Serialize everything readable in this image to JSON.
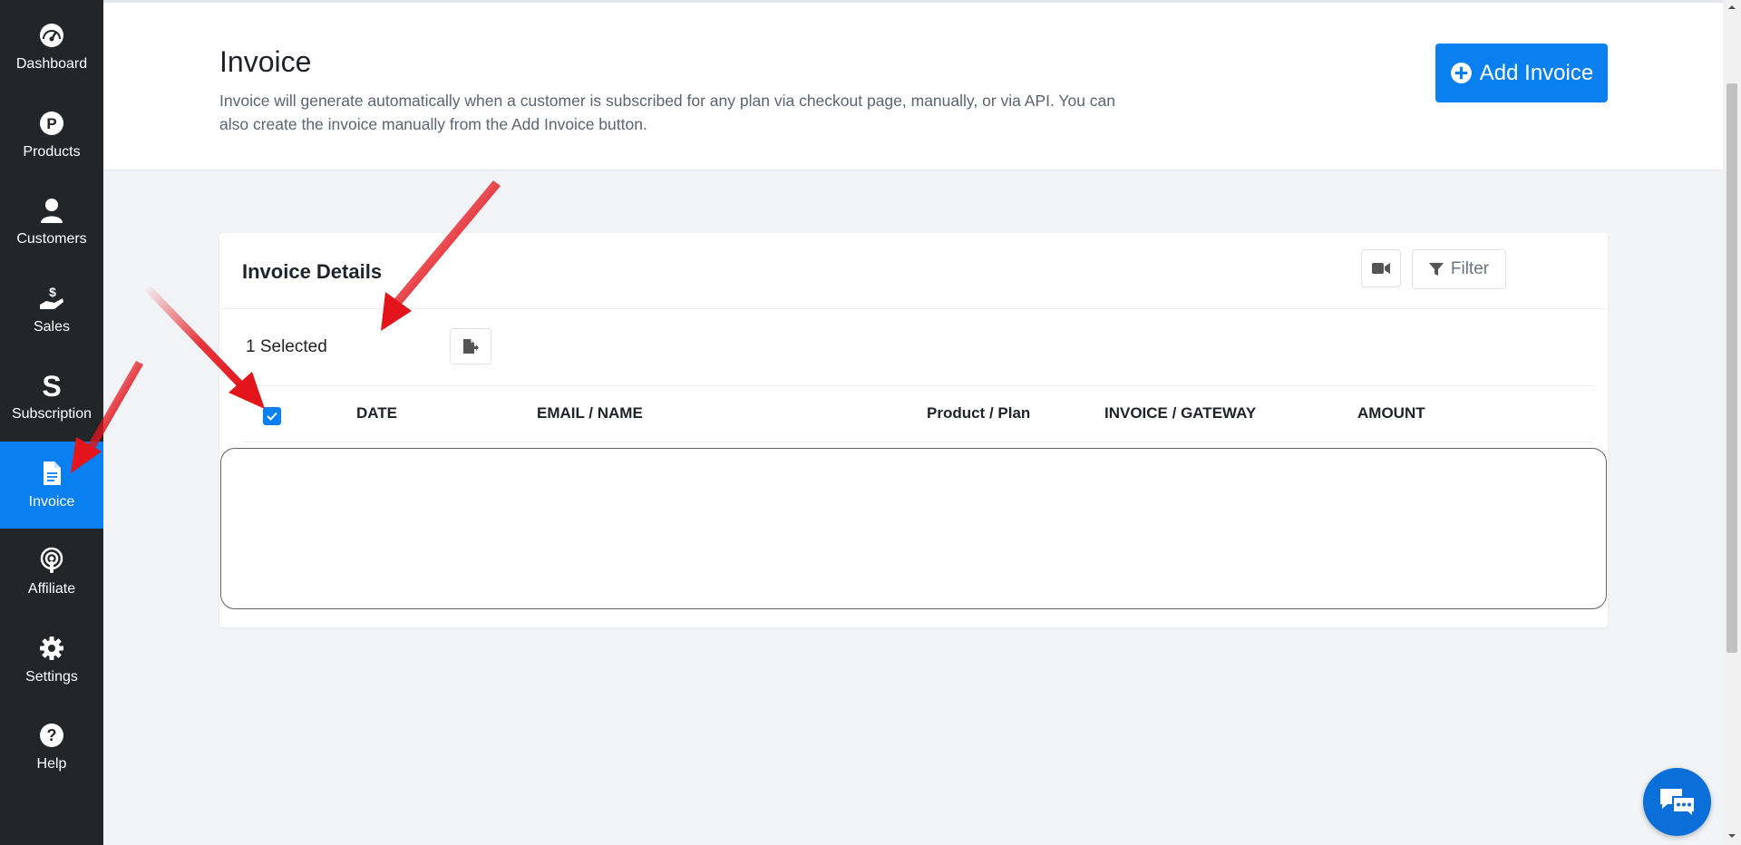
{
  "sidebar": {
    "items": [
      {
        "label": "Dashboard",
        "icon": "gauge-icon",
        "active": false
      },
      {
        "label": "Products",
        "icon": "product-p-icon",
        "active": false
      },
      {
        "label": "Customers",
        "icon": "user-icon",
        "active": false
      },
      {
        "label": "Sales",
        "icon": "hand-dollar-icon",
        "active": false
      },
      {
        "label": "Subscription",
        "icon": "subscription-s-icon",
        "active": false
      },
      {
        "label": "Invoice",
        "icon": "document-icon",
        "active": true
      },
      {
        "label": "Affiliate",
        "icon": "broadcast-icon",
        "active": false
      },
      {
        "label": "Settings",
        "icon": "gear-icon",
        "active": false
      },
      {
        "label": "Help",
        "icon": "question-icon",
        "active": false
      }
    ]
  },
  "header": {
    "title": "Invoice",
    "description": "Invoice will generate automatically when a customer is subscribed for any plan via checkout page, manually, or via API. You can also create the invoice manually from the Add Invoice button.",
    "add_button_label": "Add Invoice"
  },
  "card": {
    "title": "Invoice Details",
    "filter_label": "Filter",
    "selected_text": "1 Selected",
    "columns": [
      "DATE",
      "EMAIL / NAME",
      "Product / Plan",
      "INVOICE / GATEWAY",
      "AMOUNT"
    ],
    "rows": []
  },
  "colors": {
    "accent": "#0a80f0",
    "sidebar_bg": "#232628",
    "annotation_arrow": "#e3141b"
  }
}
